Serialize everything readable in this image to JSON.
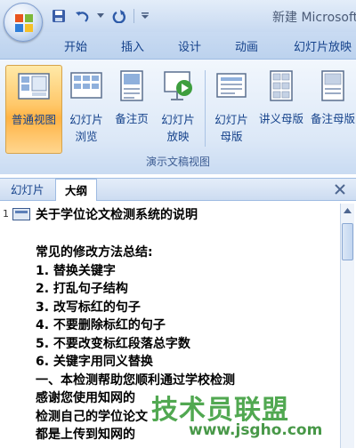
{
  "window": {
    "title": "新建 Microsoft"
  },
  "ribbon_tabs": [
    "开始",
    "插入",
    "设计",
    "动画",
    "幻灯片放映"
  ],
  "ribbon": {
    "buttons": [
      {
        "label": "普通视图",
        "active": true
      },
      {
        "label": "幻灯片\n浏览",
        "active": false
      },
      {
        "label": "备注页",
        "active": false
      },
      {
        "label": "幻灯片\n放映",
        "active": false
      },
      {
        "label": "幻灯片\n母版",
        "active": false
      },
      {
        "label": "讲义母版",
        "active": false
      },
      {
        "label": "备注母版",
        "active": false
      }
    ],
    "group_label": "演示文稿视图"
  },
  "panel": {
    "tabs": [
      "幻灯片",
      "大纲"
    ],
    "active_tab": "大纲"
  },
  "outline": {
    "slide_number": "1",
    "slide_title": "关于学位论文检测系统的说明",
    "lines": [
      "常见的修改方法总结:",
      "1. 替换关键字",
      "2. 打乱句子结构",
      "3. 改写标红的句子",
      "4. 不要删除标红的句子",
      "5. 不要改变标红段落总字数",
      "6. 关键字用同义替换",
      "一、本检测帮助您顺利通过学校检测",
      "感谢您使用知网的",
      "检测自己的学位论文",
      "都是上传到知网的"
    ]
  },
  "watermark": {
    "main": "技术员联盟",
    "url": "www.jsgho.com"
  },
  "colors": {
    "accent": "#15428b",
    "active_button": "#ffc86a",
    "watermark": "#3a9d3a"
  }
}
